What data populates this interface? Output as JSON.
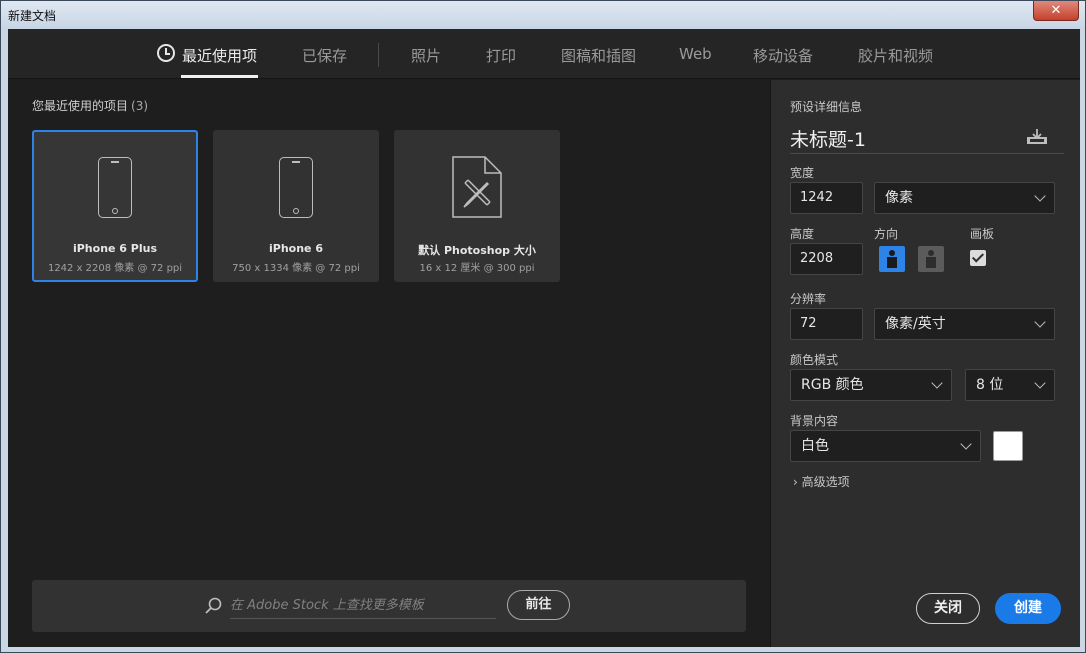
{
  "window": {
    "title": "新建文档",
    "close_icon": "close-icon"
  },
  "tabs": [
    {
      "label": "最近使用项",
      "active": true
    },
    {
      "label": "已保存"
    },
    {
      "label": "照片"
    },
    {
      "label": "打印"
    },
    {
      "label": "图稿和插图"
    },
    {
      "label": "Web"
    },
    {
      "label": "移动设备"
    },
    {
      "label": "胶片和视频"
    }
  ],
  "recent": {
    "label": "您最近使用的项目",
    "count": "(3)",
    "items": [
      {
        "name": "iPhone 6 Plus",
        "sub": "1242 x 2208 像素 @ 72 ppi",
        "icon": "phone-icon",
        "selected": true
      },
      {
        "name": "iPhone 6",
        "sub": "750 x 1334 像素 @ 72 ppi",
        "icon": "phone-icon"
      },
      {
        "name": "默认 Photoshop 大小",
        "sub": "16 x 12 厘米 @ 300 ppi",
        "icon": "document-tools-icon"
      }
    ]
  },
  "stock": {
    "placeholder": "在 Adobe Stock 上查找更多模板",
    "go_label": "前往"
  },
  "preset": {
    "header": "预设详细信息",
    "doc_title": "未标题-1",
    "width_label": "宽度",
    "width_value": "1242",
    "width_unit": "像素",
    "height_label": "高度",
    "height_value": "2208",
    "orientation_label": "方向",
    "artboard_label": "画板",
    "artboard_checked": true,
    "resolution_label": "分辨率",
    "resolution_value": "72",
    "resolution_unit": "像素/英寸",
    "color_mode_label": "颜色模式",
    "color_mode": "RGB 颜色",
    "bit_depth": "8 位",
    "background_label": "背景内容",
    "background": "白色",
    "background_color": "#ffffff",
    "advanced_label": "高级选项",
    "close_label": "关闭",
    "create_label": "创建"
  },
  "colors": {
    "accent": "#2d83e6",
    "panel": "#2d2d2e",
    "bg": "#1e1e1f"
  }
}
